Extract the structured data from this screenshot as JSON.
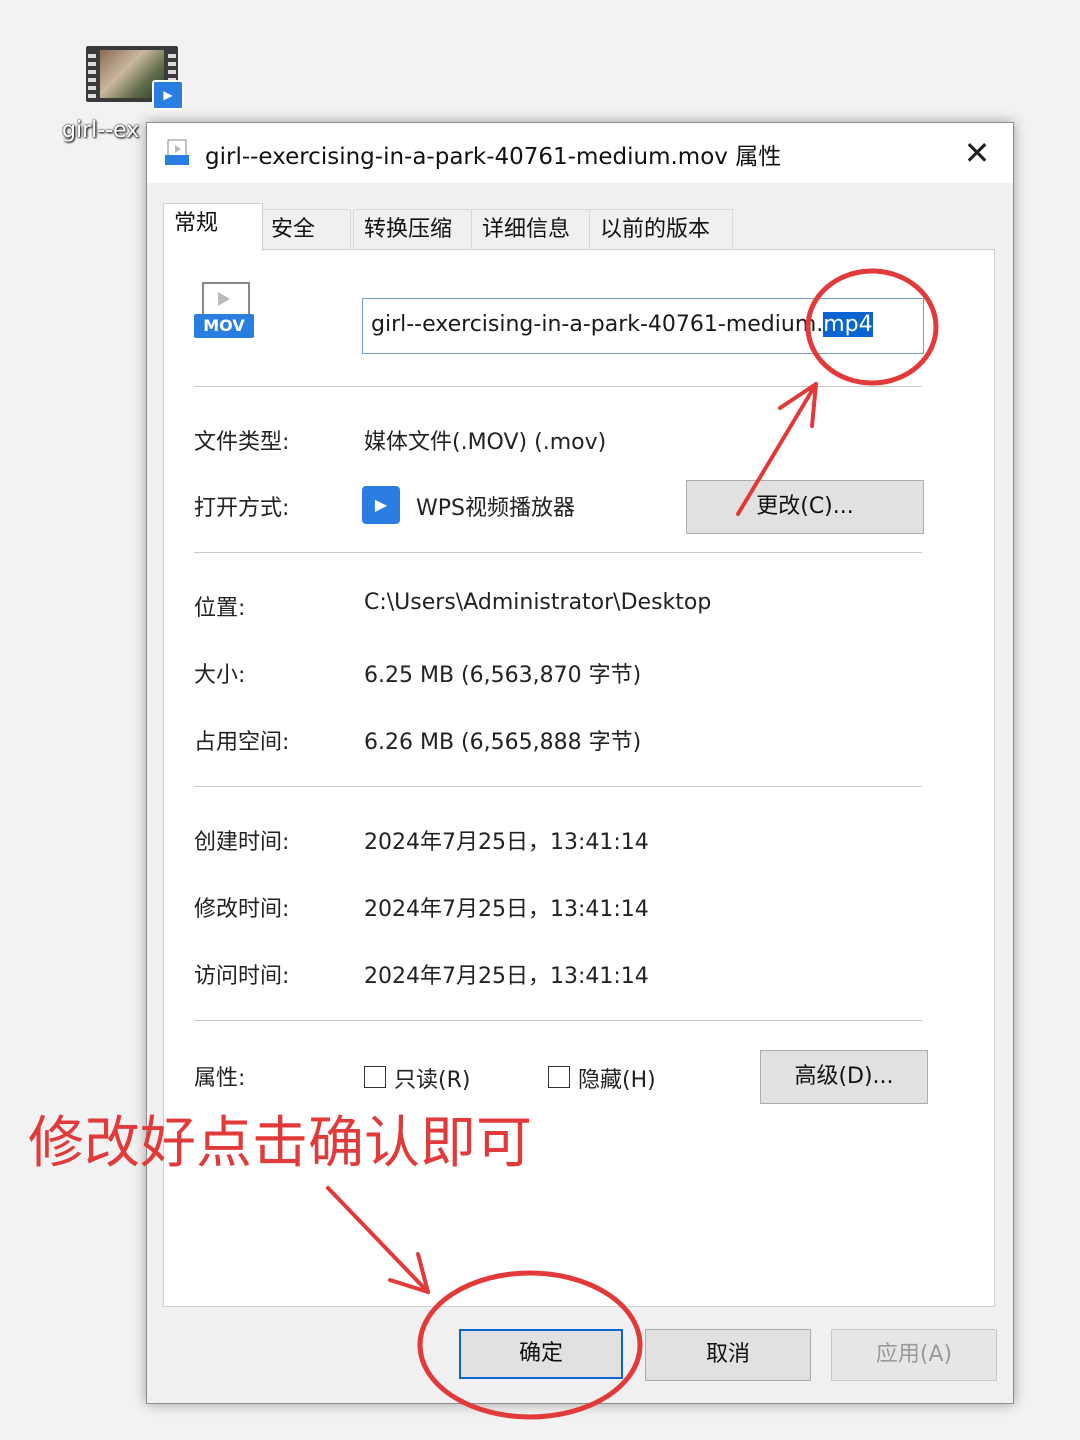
{
  "desktop": {
    "file_label": "girl--ex"
  },
  "dialog": {
    "title": "girl--exercising-in-a-park-40761-medium.mov 属性",
    "close_glyph": "✕",
    "tabs": [
      "常规",
      "安全",
      "转换压缩",
      "详细信息",
      "以前的版本"
    ],
    "file_icon_tag": "MOV",
    "filename_base": "girl--exercising-in-a-park-40761-medium.",
    "filename_ext": "mp4",
    "fields": {
      "type_label": "文件类型:",
      "type_value": "媒体文件(.MOV) (.mov)",
      "open_label": "打开方式:",
      "open_value": "WPS视频播放器",
      "change_button": "更改(C)...",
      "location_label": "位置:",
      "location_value": "C:\\Users\\Administrator\\Desktop",
      "size_label": "大小:",
      "size_value": "6.25 MB (6,563,870 字节)",
      "disk_label": "占用空间:",
      "disk_value": "6.26 MB (6,565,888 字节)",
      "created_label": "创建时间:",
      "created_value": "2024年7月25日，13:41:14",
      "modified_label": "修改时间:",
      "modified_value": "2024年7月25日，13:41:14",
      "accessed_label": "访问时间:",
      "accessed_value": "2024年7月25日，13:41:14",
      "attr_label": "属性:",
      "readonly_label": "只读(R)",
      "hidden_label": "隐藏(H)",
      "advanced_button": "高级(D)..."
    },
    "buttons": {
      "ok": "确定",
      "cancel": "取消",
      "apply": "应用(A)"
    }
  },
  "annotation": {
    "text": "修改好点击确认即可",
    "color": "#e23a3a"
  },
  "colors": {
    "selection": "#0a64d2",
    "accent": "#2a7de1"
  }
}
